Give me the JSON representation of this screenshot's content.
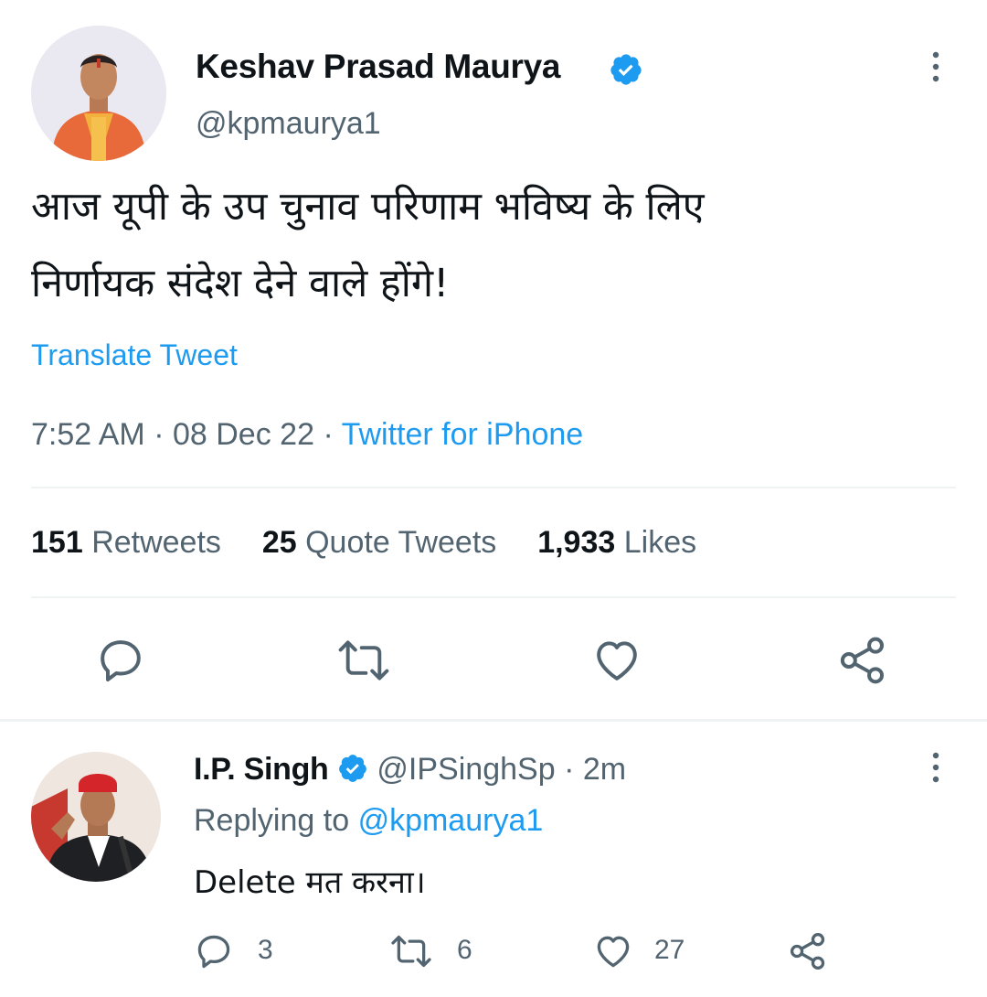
{
  "main_tweet": {
    "author_name": "Keshav Prasad Maurya",
    "author_handle": "@kpmaurya1",
    "text_line1": "आज यूपी के उप चुनाव परिणाम भविष्य के लिए",
    "text_line2": "निर्णायक संदेश देने वाले होंगे!",
    "translate_label": "Translate Tweet",
    "time": "7:52 AM",
    "date": "08 Dec 22",
    "separator": "·",
    "source": "Twitter for iPhone",
    "retweets_count": "151",
    "retweets_label": "Retweets",
    "quote_count": "25",
    "quote_label": "Quote Tweets",
    "likes_count": "1,933",
    "likes_label": "Likes"
  },
  "reply_tweet": {
    "author_name": "I.P. Singh",
    "author_handle": "@IPSinghSp",
    "age": "· 2m",
    "replying_prefix": "Replying to",
    "replying_handle": "@kpmaurya1",
    "text": "Delete मत करना।",
    "reply_count": "3",
    "retweet_count": "6",
    "like_count": "27"
  },
  "colors": {
    "accent": "#1d9bf0",
    "muted": "#536471",
    "text": "#0f1419",
    "divider": "#eff3f4"
  },
  "icons": [
    "verified-badge-icon",
    "more-options-icon",
    "reply-icon",
    "retweet-icon",
    "like-icon",
    "share-icon"
  ]
}
